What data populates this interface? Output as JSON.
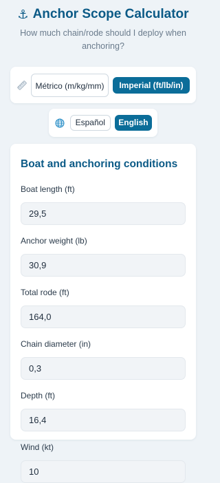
{
  "header": {
    "title": "Anchor Scope Calculator",
    "subtitle": "How much chain/rode should I deploy when anchoring?"
  },
  "units": {
    "icon": "ruler-icon",
    "metric_label": "Métrico (m/kg/mm)",
    "imperial_label": "Imperial (ft/lb/in)",
    "selected": "imperial"
  },
  "language": {
    "icon": "globe-icon",
    "spanish_label": "Español",
    "english_label": "English",
    "selected": "english"
  },
  "form": {
    "section_title": "Boat and anchoring conditions",
    "fields": [
      {
        "label": "Boat length (ft)",
        "value": "29,5"
      },
      {
        "label": "Anchor weight (lb)",
        "value": "30,9"
      },
      {
        "label": "Total rode (ft)",
        "value": "164,0"
      },
      {
        "label": "Chain diameter (in)",
        "value": "0,3"
      },
      {
        "label": "Depth (ft)",
        "value": "16,4"
      },
      {
        "label": "Wind (kt)",
        "value": "10"
      }
    ]
  },
  "colors": {
    "accent": "#0b6d99",
    "title": "#0b5a86",
    "background": "#eef3f7"
  }
}
